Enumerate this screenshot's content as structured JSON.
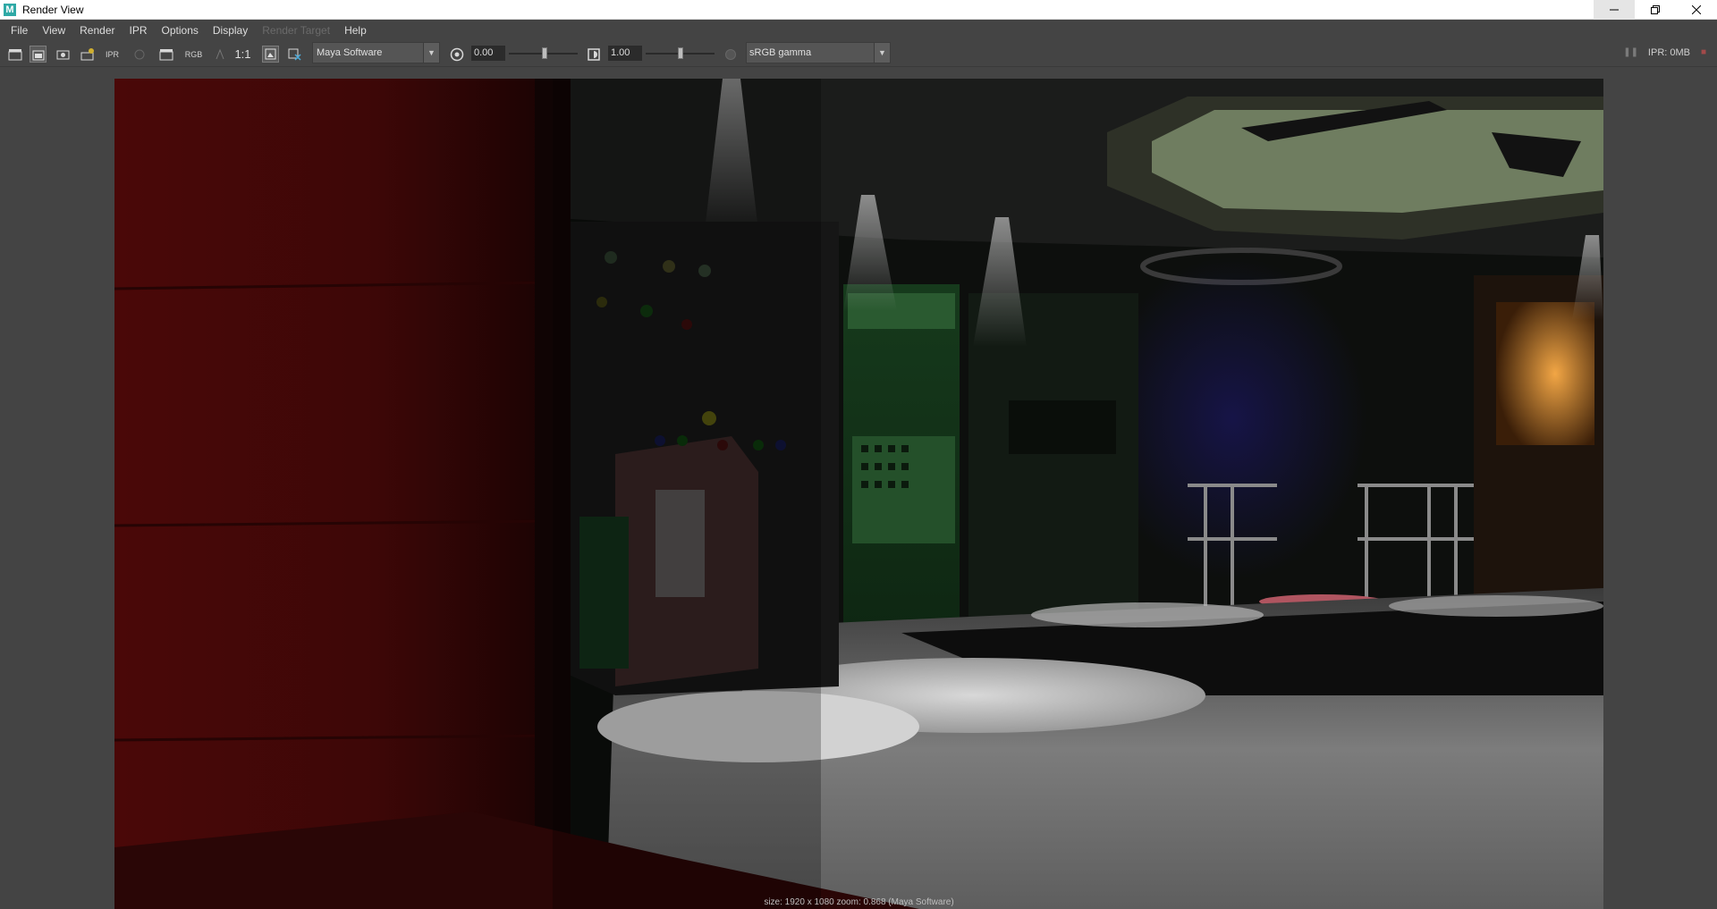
{
  "window": {
    "title": "Render View",
    "app_icon_letter": "M",
    "controls": {
      "minimize": "minimize-icon",
      "restore": "restore-icon",
      "close": "close-icon"
    }
  },
  "menu": {
    "items": [
      {
        "label": "File",
        "enabled": true
      },
      {
        "label": "View",
        "enabled": true
      },
      {
        "label": "Render",
        "enabled": true
      },
      {
        "label": "IPR",
        "enabled": true
      },
      {
        "label": "Options",
        "enabled": true
      },
      {
        "label": "Display",
        "enabled": true
      },
      {
        "label": "Render Target",
        "enabled": false
      },
      {
        "label": "Help",
        "enabled": true
      }
    ]
  },
  "toolbar": {
    "rgb_label": "RGB",
    "one_to_one_label": "1:1",
    "renderer": "Maya Software",
    "exposure": "0.00",
    "gamma": "1.00",
    "color_space": "sRGB gamma",
    "ipr_memory": "IPR: 0MB"
  },
  "render": {
    "status": "size: 1920 x 1080 zoom: 0.868       (Maya Software)"
  }
}
